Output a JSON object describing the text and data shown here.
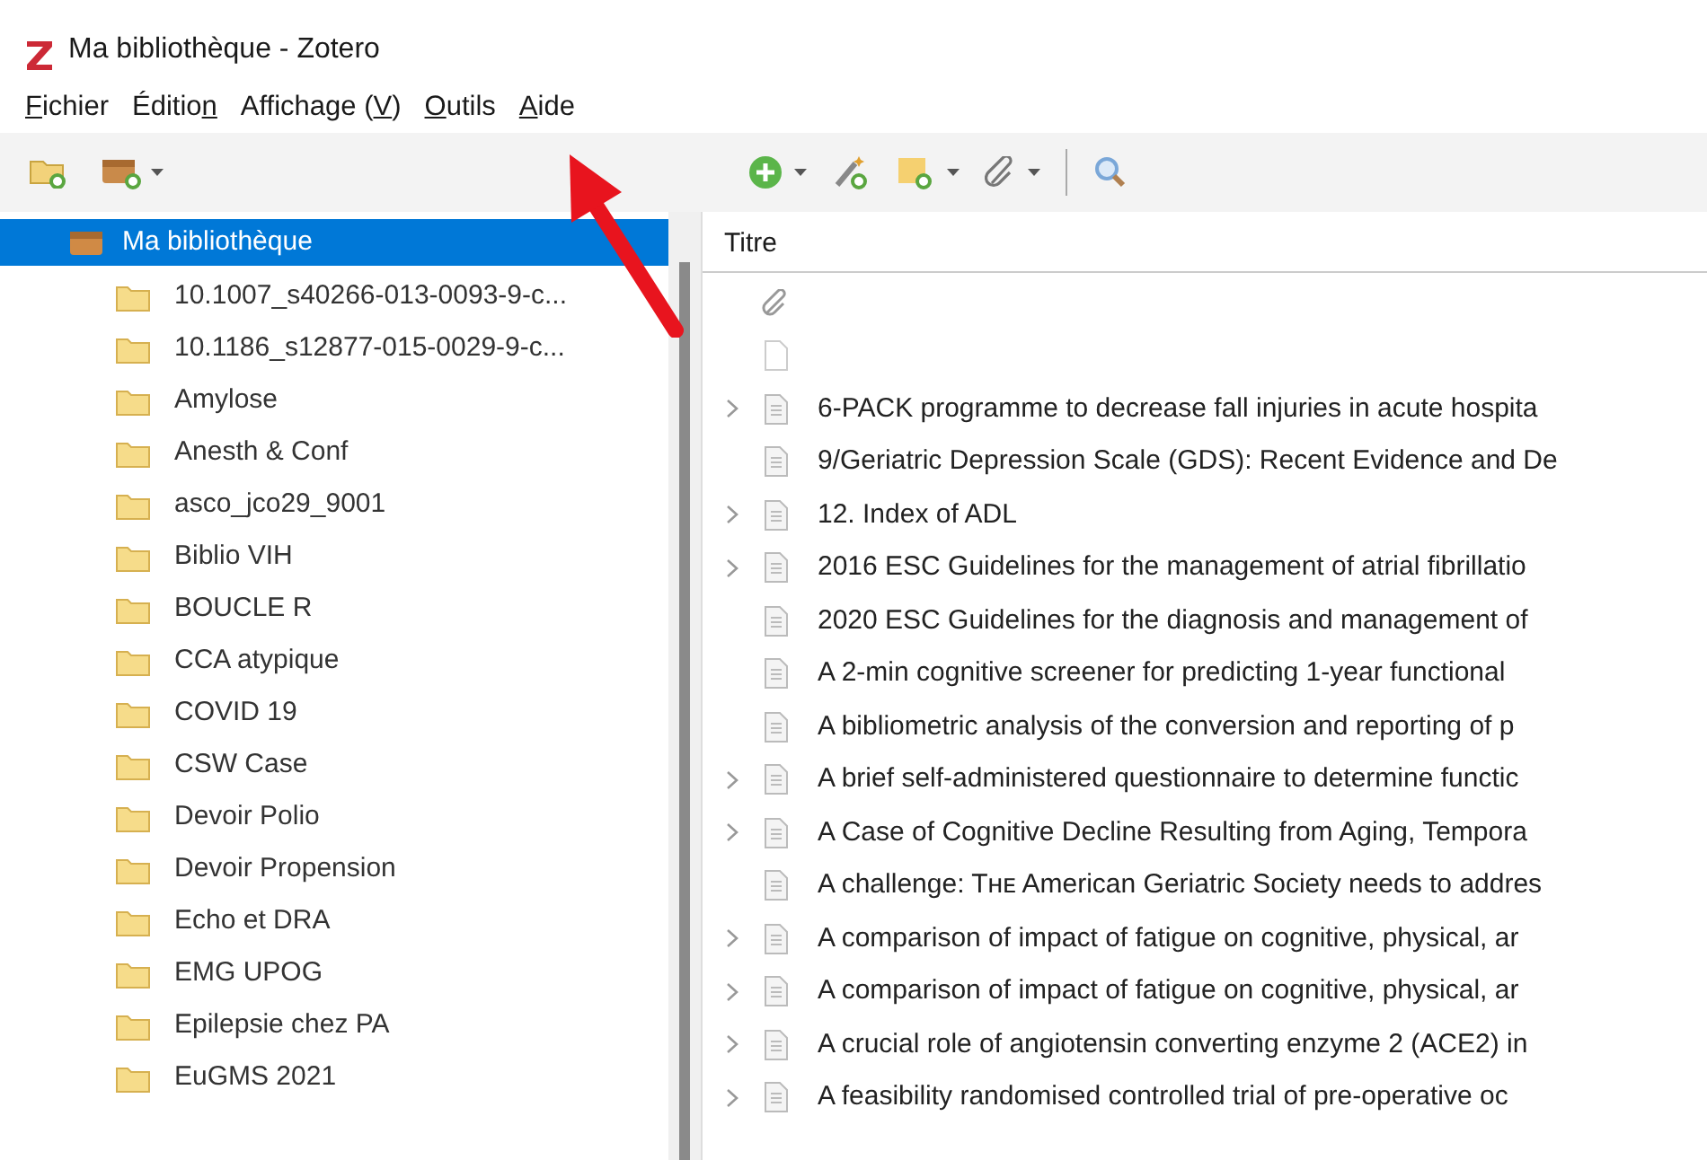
{
  "window": {
    "title": "Ma bibliothèque - Zotero"
  },
  "menu": [
    {
      "key": "F",
      "post": "ichier"
    },
    {
      "pre": "Éditio",
      "key": "n"
    },
    {
      "pre": "Affichage (",
      "key": "V",
      "post": ")"
    },
    {
      "key": "O",
      "post": "utils"
    },
    {
      "key": "A",
      "post": "ide"
    }
  ],
  "collections": {
    "library": {
      "label": "Ma bibliothèque",
      "selected": true
    },
    "items": [
      {
        "label": "10.1007_s40266-013-0093-9-c..."
      },
      {
        "label": "10.1186_s12877-015-0029-9-c..."
      },
      {
        "label": "Amylose"
      },
      {
        "label": "Anesth & Conf"
      },
      {
        "label": "asco_jco29_9001"
      },
      {
        "label": "Biblio VIH"
      },
      {
        "label": "BOUCLE R"
      },
      {
        "label": "CCA atypique"
      },
      {
        "label": "COVID 19"
      },
      {
        "label": "CSW Case"
      },
      {
        "label": "Devoir Polio"
      },
      {
        "label": "Devoir Propension"
      },
      {
        "label": "Echo et DRA"
      },
      {
        "label": "EMG UPOG"
      },
      {
        "label": "Epilepsie chez PA"
      },
      {
        "label": "EuGMS 2021"
      }
    ]
  },
  "items_table": {
    "columns": [
      "Titre"
    ],
    "rows": [
      {
        "kind": "attachment",
        "expandable": false
      },
      {
        "kind": "blank",
        "expandable": false
      },
      {
        "kind": "document",
        "title": "6-PACK programme to decrease fall injuries in acute hospita",
        "expandable": true
      },
      {
        "kind": "document",
        "title": "9/Geriatric Depression Scale (GDS): Recent Evidence and De",
        "expandable": false
      },
      {
        "kind": "document",
        "title": "12. Index of ADL",
        "expandable": true
      },
      {
        "kind": "document",
        "title": "2016 ESC Guidelines for the management of atrial fibrillatio",
        "expandable": true
      },
      {
        "kind": "document",
        "title": "2020 ESC Guidelines for the diagnosis and management of",
        "expandable": false
      },
      {
        "kind": "document",
        "title": "A 2-min cognitive screener for predicting 1-year functional",
        "expandable": false
      },
      {
        "kind": "document",
        "title": "A bibliometric analysis of the conversion and reporting of p",
        "expandable": false
      },
      {
        "kind": "document",
        "title": "A brief self-administered questionnaire to determine functic",
        "expandable": true
      },
      {
        "kind": "document",
        "title": "A Case of Cognitive Decline Resulting from Aging, Tempora",
        "expandable": true
      },
      {
        "kind": "document",
        "title": "A challenge: Tʜᴇ American Geriatric Society needs to addres",
        "expandable": false
      },
      {
        "kind": "document",
        "title": "A comparison of impact of fatigue on cognitive, physical, ar",
        "expandable": true
      },
      {
        "kind": "document",
        "title": "A comparison of impact of fatigue on cognitive, physical, ar",
        "expandable": true
      },
      {
        "kind": "document",
        "title": "A crucial role of angiotensin converting enzyme 2 (ACE2) in",
        "expandable": true
      },
      {
        "kind": "document",
        "title": "A feasibility randomised controlled trial of pre-operative oc",
        "expandable": true
      }
    ]
  },
  "annotation_arrow": true
}
